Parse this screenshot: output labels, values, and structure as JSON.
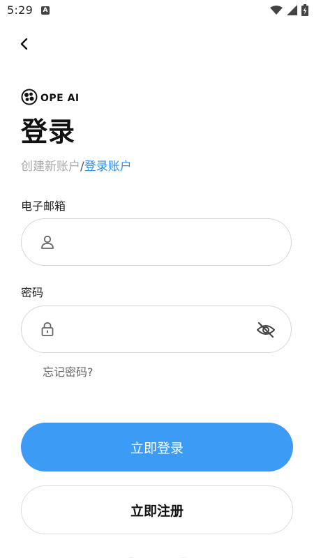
{
  "status_bar": {
    "time": "5:29",
    "notification_icon": "A"
  },
  "logo": {
    "text": "OPE AI"
  },
  "title": "登录",
  "sub_links": {
    "create": "创建新账户",
    "separator": "/",
    "login": "登录账户"
  },
  "email": {
    "label": "电子邮箱",
    "value": "",
    "placeholder": ""
  },
  "password": {
    "label": "密码",
    "value": "",
    "placeholder": ""
  },
  "forgot": "忘记密码?",
  "buttons": {
    "login": "立即登录",
    "register": "立即注册"
  },
  "colors": {
    "primary": "#3b9bf5",
    "link": "#2f8fe8",
    "border": "#d6d6d6"
  },
  "icons": {
    "back": "chevron-left-icon",
    "email": "user-icon",
    "password": "lock-icon",
    "toggle": "eye-off-icon",
    "wifi": "wifi-icon",
    "signal": "signal-icon",
    "battery": "battery-charging-icon"
  }
}
